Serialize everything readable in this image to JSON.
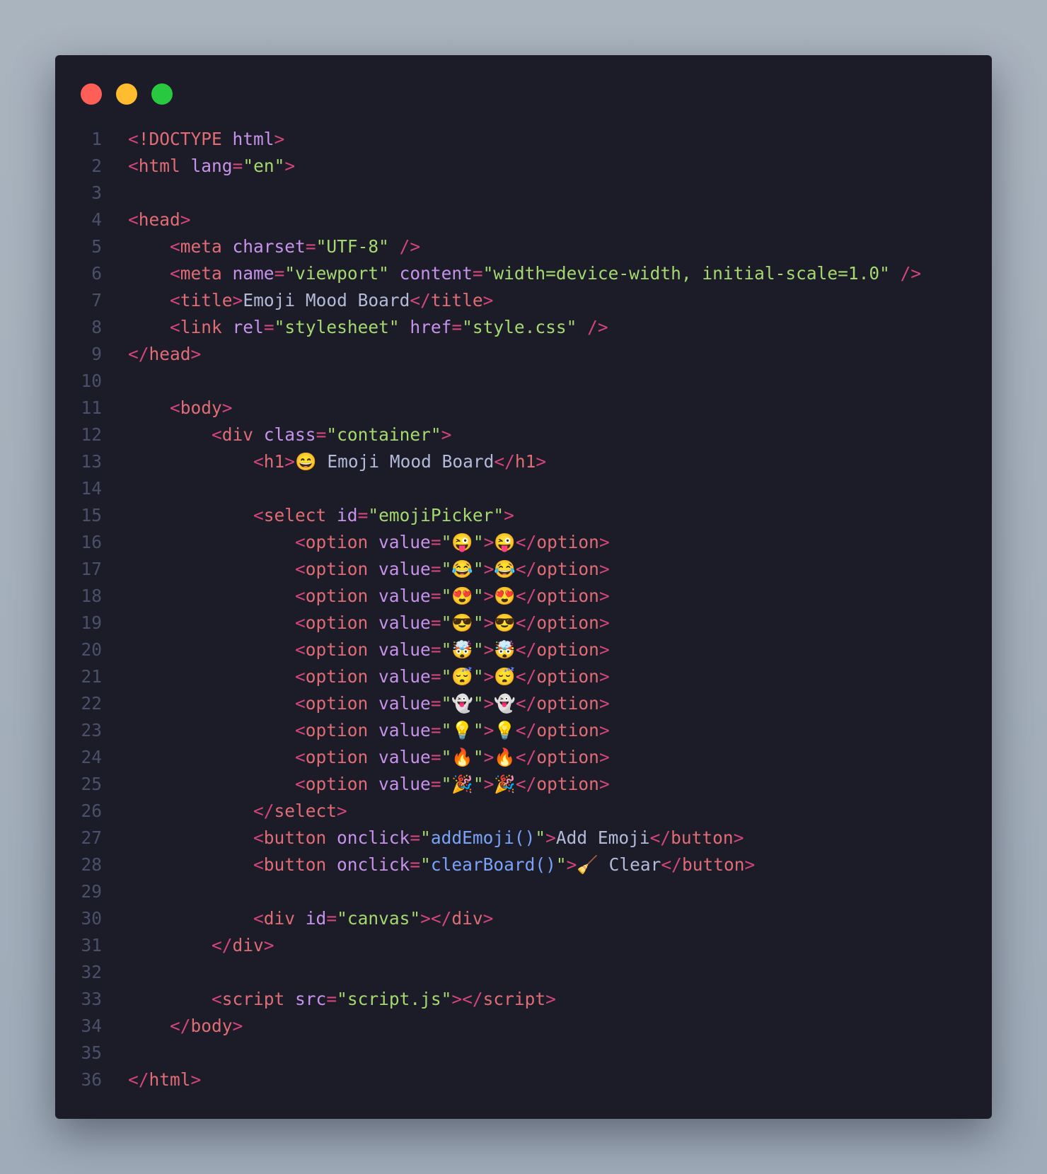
{
  "window": {
    "lights": [
      "red",
      "yellow",
      "green"
    ],
    "colors": {
      "background": "#1b1c28",
      "line_number": "#4b5069",
      "punctuation": "#d4457a",
      "tag": "#e06c75",
      "attribute": "#c792ea",
      "string": "#a5d86f",
      "function": "#7aa2f7",
      "text": "#b3bad8"
    }
  },
  "code": {
    "lines": [
      [
        [
          "p",
          "<"
        ],
        [
          "t",
          "!DOCTYPE "
        ],
        [
          "a",
          "html"
        ],
        [
          "p",
          ">"
        ]
      ],
      [
        [
          "p",
          "<"
        ],
        [
          "t",
          "html "
        ],
        [
          "a",
          "lang"
        ],
        [
          "p",
          "="
        ],
        [
          "s",
          "\"en\""
        ],
        [
          "p",
          ">"
        ]
      ],
      [],
      [
        [
          "p",
          "<"
        ],
        [
          "t",
          "head"
        ],
        [
          "p",
          ">"
        ]
      ],
      [
        [
          "x",
          "    "
        ],
        [
          "p",
          "<"
        ],
        [
          "t",
          "meta "
        ],
        [
          "a",
          "charset"
        ],
        [
          "p",
          "="
        ],
        [
          "s",
          "\"UTF-8\" "
        ],
        [
          "p",
          "/>"
        ]
      ],
      [
        [
          "x",
          "    "
        ],
        [
          "p",
          "<"
        ],
        [
          "t",
          "meta "
        ],
        [
          "a",
          "name"
        ],
        [
          "p",
          "="
        ],
        [
          "s",
          "\"viewport\" "
        ],
        [
          "a",
          "content"
        ],
        [
          "p",
          "="
        ],
        [
          "s",
          "\"width=device-width, initial-scale=1.0\" "
        ],
        [
          "p",
          "/>"
        ]
      ],
      [
        [
          "x",
          "    "
        ],
        [
          "p",
          "<"
        ],
        [
          "t",
          "title"
        ],
        [
          "p",
          ">"
        ],
        [
          "x",
          "Emoji Mood Board"
        ],
        [
          "p",
          "</"
        ],
        [
          "t",
          "title"
        ],
        [
          "p",
          ">"
        ]
      ],
      [
        [
          "x",
          "    "
        ],
        [
          "p",
          "<"
        ],
        [
          "t",
          "link "
        ],
        [
          "a",
          "rel"
        ],
        [
          "p",
          "="
        ],
        [
          "s",
          "\"stylesheet\" "
        ],
        [
          "a",
          "href"
        ],
        [
          "p",
          "="
        ],
        [
          "s",
          "\"style.css\" "
        ],
        [
          "p",
          "/>"
        ]
      ],
      [
        [
          "p",
          "</"
        ],
        [
          "t",
          "head"
        ],
        [
          "p",
          ">"
        ]
      ],
      [],
      [
        [
          "x",
          "    "
        ],
        [
          "p",
          "<"
        ],
        [
          "t",
          "body"
        ],
        [
          "p",
          ">"
        ]
      ],
      [
        [
          "x",
          "        "
        ],
        [
          "p",
          "<"
        ],
        [
          "t",
          "div "
        ],
        [
          "a",
          "class"
        ],
        [
          "p",
          "="
        ],
        [
          "s",
          "\"container\""
        ],
        [
          "p",
          ">"
        ]
      ],
      [
        [
          "x",
          "            "
        ],
        [
          "p",
          "<"
        ],
        [
          "t",
          "h1"
        ],
        [
          "p",
          ">"
        ],
        [
          "e",
          "😄"
        ],
        [
          "x",
          " Emoji Mood Board"
        ],
        [
          "p",
          "</"
        ],
        [
          "t",
          "h1"
        ],
        [
          "p",
          ">"
        ]
      ],
      [],
      [
        [
          "x",
          "            "
        ],
        [
          "p",
          "<"
        ],
        [
          "t",
          "select "
        ],
        [
          "a",
          "id"
        ],
        [
          "p",
          "="
        ],
        [
          "s",
          "\"emojiPicker\""
        ],
        [
          "p",
          ">"
        ]
      ],
      [
        [
          "x",
          "                "
        ],
        [
          "p",
          "<"
        ],
        [
          "t",
          "option "
        ],
        [
          "a",
          "value"
        ],
        [
          "p",
          "="
        ],
        [
          "s",
          "\""
        ],
        [
          "e",
          "😜"
        ],
        [
          "s",
          "\""
        ],
        [
          "p",
          ">"
        ],
        [
          "e",
          "😜"
        ],
        [
          "p",
          "</"
        ],
        [
          "t",
          "option"
        ],
        [
          "p",
          ">"
        ]
      ],
      [
        [
          "x",
          "                "
        ],
        [
          "p",
          "<"
        ],
        [
          "t",
          "option "
        ],
        [
          "a",
          "value"
        ],
        [
          "p",
          "="
        ],
        [
          "s",
          "\""
        ],
        [
          "e",
          "😂"
        ],
        [
          "s",
          "\""
        ],
        [
          "p",
          ">"
        ],
        [
          "e",
          "😂"
        ],
        [
          "p",
          "</"
        ],
        [
          "t",
          "option"
        ],
        [
          "p",
          ">"
        ]
      ],
      [
        [
          "x",
          "                "
        ],
        [
          "p",
          "<"
        ],
        [
          "t",
          "option "
        ],
        [
          "a",
          "value"
        ],
        [
          "p",
          "="
        ],
        [
          "s",
          "\""
        ],
        [
          "e",
          "😍"
        ],
        [
          "s",
          "\""
        ],
        [
          "p",
          ">"
        ],
        [
          "e",
          "😍"
        ],
        [
          "p",
          "</"
        ],
        [
          "t",
          "option"
        ],
        [
          "p",
          ">"
        ]
      ],
      [
        [
          "x",
          "                "
        ],
        [
          "p",
          "<"
        ],
        [
          "t",
          "option "
        ],
        [
          "a",
          "value"
        ],
        [
          "p",
          "="
        ],
        [
          "s",
          "\""
        ],
        [
          "e",
          "😎"
        ],
        [
          "s",
          "\""
        ],
        [
          "p",
          ">"
        ],
        [
          "e",
          "😎"
        ],
        [
          "p",
          "</"
        ],
        [
          "t",
          "option"
        ],
        [
          "p",
          ">"
        ]
      ],
      [
        [
          "x",
          "                "
        ],
        [
          "p",
          "<"
        ],
        [
          "t",
          "option "
        ],
        [
          "a",
          "value"
        ],
        [
          "p",
          "="
        ],
        [
          "s",
          "\""
        ],
        [
          "e",
          "🤯"
        ],
        [
          "s",
          "\""
        ],
        [
          "p",
          ">"
        ],
        [
          "e",
          "🤯"
        ],
        [
          "p",
          "</"
        ],
        [
          "t",
          "option"
        ],
        [
          "p",
          ">"
        ]
      ],
      [
        [
          "x",
          "                "
        ],
        [
          "p",
          "<"
        ],
        [
          "t",
          "option "
        ],
        [
          "a",
          "value"
        ],
        [
          "p",
          "="
        ],
        [
          "s",
          "\""
        ],
        [
          "e",
          "😴"
        ],
        [
          "s",
          "\""
        ],
        [
          "p",
          ">"
        ],
        [
          "e",
          "😴"
        ],
        [
          "p",
          "</"
        ],
        [
          "t",
          "option"
        ],
        [
          "p",
          ">"
        ]
      ],
      [
        [
          "x",
          "                "
        ],
        [
          "p",
          "<"
        ],
        [
          "t",
          "option "
        ],
        [
          "a",
          "value"
        ],
        [
          "p",
          "="
        ],
        [
          "s",
          "\""
        ],
        [
          "e",
          "👻"
        ],
        [
          "s",
          "\""
        ],
        [
          "p",
          ">"
        ],
        [
          "e",
          "👻"
        ],
        [
          "p",
          "</"
        ],
        [
          "t",
          "option"
        ],
        [
          "p",
          ">"
        ]
      ],
      [
        [
          "x",
          "                "
        ],
        [
          "p",
          "<"
        ],
        [
          "t",
          "option "
        ],
        [
          "a",
          "value"
        ],
        [
          "p",
          "="
        ],
        [
          "s",
          "\""
        ],
        [
          "e",
          "💡"
        ],
        [
          "s",
          "\""
        ],
        [
          "p",
          ">"
        ],
        [
          "e",
          "💡"
        ],
        [
          "p",
          "</"
        ],
        [
          "t",
          "option"
        ],
        [
          "p",
          ">"
        ]
      ],
      [
        [
          "x",
          "                "
        ],
        [
          "p",
          "<"
        ],
        [
          "t",
          "option "
        ],
        [
          "a",
          "value"
        ],
        [
          "p",
          "="
        ],
        [
          "s",
          "\""
        ],
        [
          "e",
          "🔥"
        ],
        [
          "s",
          "\""
        ],
        [
          "p",
          ">"
        ],
        [
          "e",
          "🔥"
        ],
        [
          "p",
          "</"
        ],
        [
          "t",
          "option"
        ],
        [
          "p",
          ">"
        ]
      ],
      [
        [
          "x",
          "                "
        ],
        [
          "p",
          "<"
        ],
        [
          "t",
          "option "
        ],
        [
          "a",
          "value"
        ],
        [
          "p",
          "="
        ],
        [
          "s",
          "\""
        ],
        [
          "e",
          "🎉"
        ],
        [
          "s",
          "\""
        ],
        [
          "p",
          ">"
        ],
        [
          "e",
          "🎉"
        ],
        [
          "p",
          "</"
        ],
        [
          "t",
          "option"
        ],
        [
          "p",
          ">"
        ]
      ],
      [
        [
          "x",
          "            "
        ],
        [
          "p",
          "</"
        ],
        [
          "t",
          "select"
        ],
        [
          "p",
          ">"
        ]
      ],
      [
        [
          "x",
          "            "
        ],
        [
          "p",
          "<"
        ],
        [
          "t",
          "button "
        ],
        [
          "a",
          "onclick"
        ],
        [
          "p",
          "="
        ],
        [
          "s",
          "\""
        ],
        [
          "f",
          "addEmoji()"
        ],
        [
          "s",
          "\""
        ],
        [
          "p",
          ">"
        ],
        [
          "x",
          "Add Emoji"
        ],
        [
          "p",
          "</"
        ],
        [
          "t",
          "button"
        ],
        [
          "p",
          ">"
        ]
      ],
      [
        [
          "x",
          "            "
        ],
        [
          "p",
          "<"
        ],
        [
          "t",
          "button "
        ],
        [
          "a",
          "onclick"
        ],
        [
          "p",
          "="
        ],
        [
          "s",
          "\""
        ],
        [
          "f",
          "clearBoard()"
        ],
        [
          "s",
          "\""
        ],
        [
          "p",
          ">"
        ],
        [
          "e",
          "🧹"
        ],
        [
          "x",
          " Clear"
        ],
        [
          "p",
          "</"
        ],
        [
          "t",
          "button"
        ],
        [
          "p",
          ">"
        ]
      ],
      [],
      [
        [
          "x",
          "            "
        ],
        [
          "p",
          "<"
        ],
        [
          "t",
          "div "
        ],
        [
          "a",
          "id"
        ],
        [
          "p",
          "="
        ],
        [
          "s",
          "\"canvas\""
        ],
        [
          "p",
          "></"
        ],
        [
          "t",
          "div"
        ],
        [
          "p",
          ">"
        ]
      ],
      [
        [
          "x",
          "        "
        ],
        [
          "p",
          "</"
        ],
        [
          "t",
          "div"
        ],
        [
          "p",
          ">"
        ]
      ],
      [],
      [
        [
          "x",
          "        "
        ],
        [
          "p",
          "<"
        ],
        [
          "t",
          "script "
        ],
        [
          "a",
          "src"
        ],
        [
          "p",
          "="
        ],
        [
          "s",
          "\"script.js\""
        ],
        [
          "p",
          "></"
        ],
        [
          "t",
          "script"
        ],
        [
          "p",
          ">"
        ]
      ],
      [
        [
          "x",
          "    "
        ],
        [
          "p",
          "</"
        ],
        [
          "t",
          "body"
        ],
        [
          "p",
          ">"
        ]
      ],
      [],
      [
        [
          "p",
          "</"
        ],
        [
          "t",
          "html"
        ],
        [
          "p",
          ">"
        ]
      ]
    ]
  }
}
